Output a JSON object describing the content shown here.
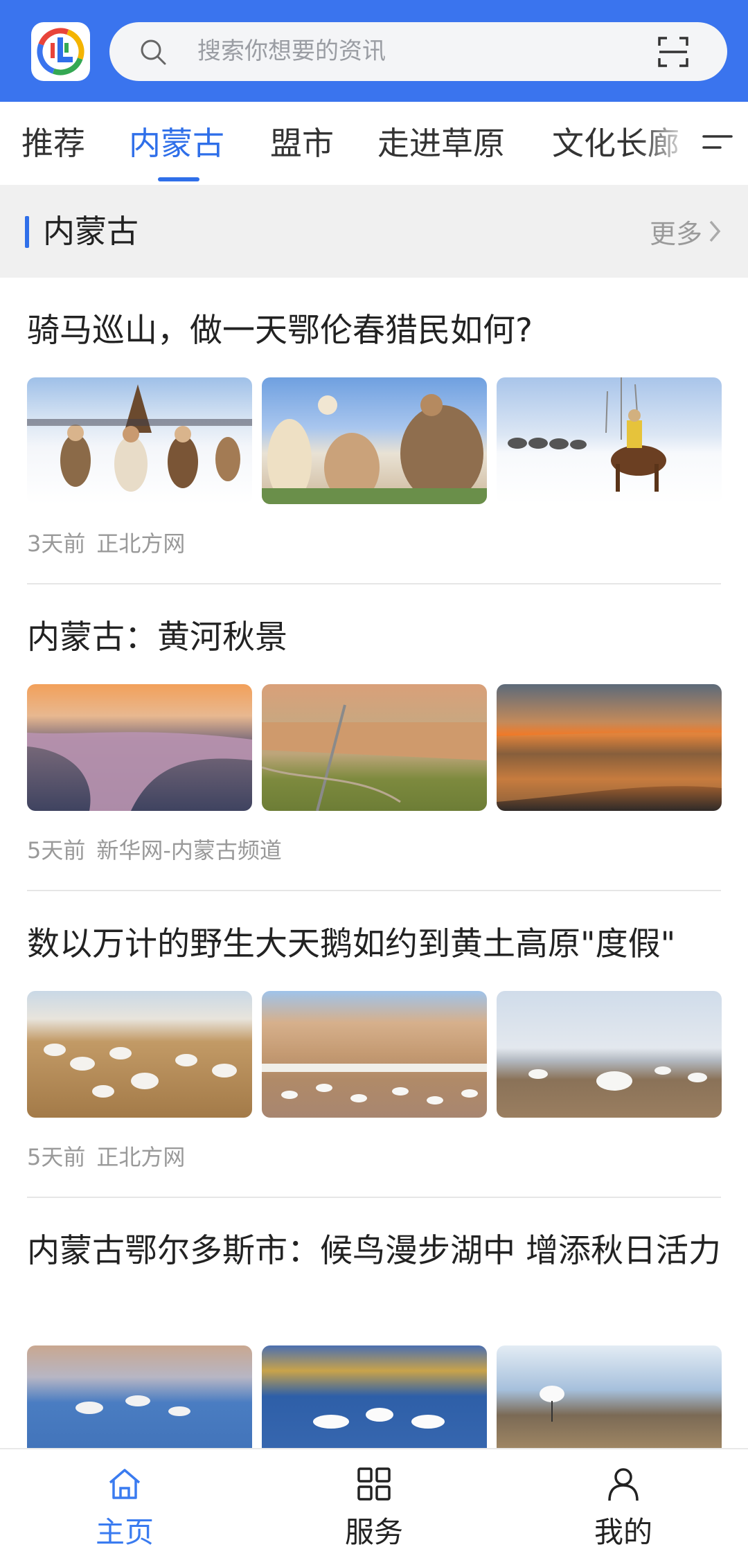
{
  "header": {
    "search_placeholder": "搜索你想要的资讯"
  },
  "tabs": [
    {
      "label": "推荐"
    },
    {
      "label": "内蒙古",
      "active": true
    },
    {
      "label": "盟市"
    },
    {
      "label": "走进草原"
    },
    {
      "label": "文化长廊"
    }
  ],
  "section": {
    "title": "内蒙古",
    "more_label": "更多"
  },
  "articles": [
    {
      "title": "骑马巡山，做一天鄂伦春猎民如何?",
      "time": "3天前",
      "source": "正北方网"
    },
    {
      "title": "内蒙古：黄河秋景",
      "time": "5天前",
      "source": "新华网-内蒙古频道"
    },
    {
      "title": "数以万计的野生大天鹅如约到黄土高原\"度假\"",
      "time": "5天前",
      "source": "正北方网"
    },
    {
      "title": "内蒙古鄂尔多斯市：候鸟漫步湖中  增添秋日活力"
    }
  ],
  "bottom_nav": [
    {
      "label": "主页",
      "icon": "home-icon",
      "active": true
    },
    {
      "label": "服务",
      "icon": "grid-icon"
    },
    {
      "label": "我的",
      "icon": "user-icon"
    }
  ],
  "colors": {
    "brand": "#3a74ee",
    "active_tab": "#2f6fe9",
    "nav_active": "#3a7bf0"
  }
}
